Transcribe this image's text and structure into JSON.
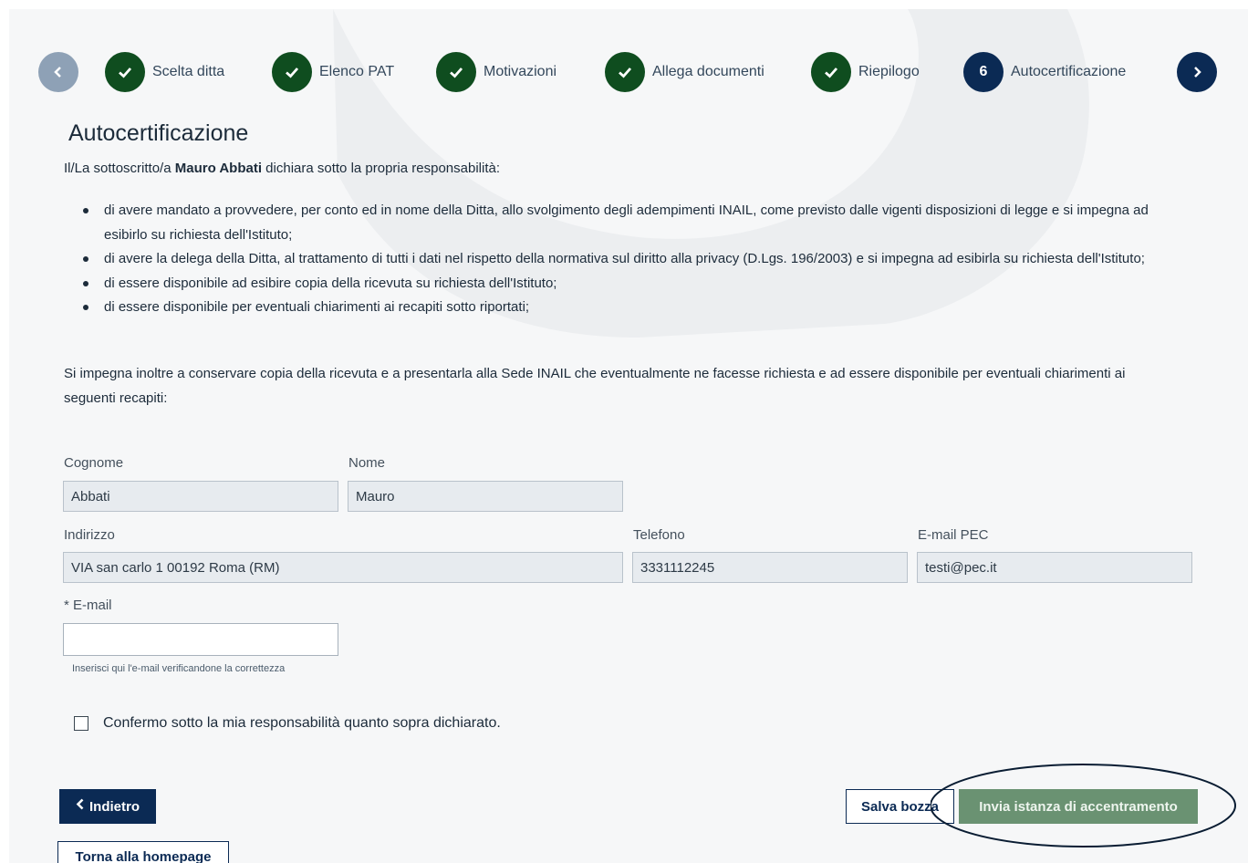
{
  "stepper": {
    "prev_icon": "chevron-left-icon",
    "next_icon": "chevron-right-icon",
    "steps": [
      {
        "label": "Scelta ditta",
        "status": "completed",
        "icon": "check-icon"
      },
      {
        "label": "Elenco PAT",
        "status": "completed",
        "icon": "check-icon"
      },
      {
        "label": "Motivazioni",
        "status": "completed",
        "icon": "check-icon"
      },
      {
        "label": "Allega documenti",
        "status": "completed",
        "icon": "check-icon"
      },
      {
        "label": "Riepilogo",
        "status": "completed",
        "icon": "check-icon"
      },
      {
        "label": "Autocertificazione",
        "status": "active",
        "number": "6"
      }
    ]
  },
  "page": {
    "title": "Autocertificazione",
    "intro_prefix": "Il/La sottoscritto/a ",
    "intro_name": "Mauro Abbati",
    "intro_suffix": " dichiara sotto la propria responsabilità:",
    "bullets": [
      "di avere mandato a provvedere, per conto ed in nome della Ditta, allo svolgimento degli adempimenti INAIL, come previsto dalle vigenti disposizioni di legge e si impegna ad esibirlo su richiesta dell'Istituto;",
      "di avere la delega della Ditta, al trattamento di tutti i dati nel rispetto della normativa sul diritto alla privacy (D.Lgs. 196/2003) e si impegna ad esibirla su richiesta dell'Istituto;",
      "di essere disponibile ad esibire copia della ricevuta su richiesta dell'Istituto;",
      "di essere disponibile per eventuali chiarimenti ai recapiti sotto riportati;"
    ],
    "commitment": "Si impegna inoltre a conservare copia della ricevuta e a presentarla alla Sede INAIL che eventualmente ne facesse richiesta e ad essere disponibile per eventuali chiarimenti ai seguenti recapiti:"
  },
  "form": {
    "cognome_label": "Cognome",
    "cognome_value": "Abbati",
    "nome_label": "Nome",
    "nome_value": "Mauro",
    "indirizzo_label": "Indirizzo",
    "indirizzo_value": "VIA san carlo 1 00192 Roma (RM)",
    "telefono_label": "Telefono",
    "telefono_value": "3331112245",
    "pec_label": "E-mail PEC",
    "pec_value": "testi@pec.it",
    "email_label": "* E-mail",
    "email_value": "",
    "email_hint": "Inserisci qui l'e-mail verificandone la correttezza",
    "confirm_label": "Confermo sotto la mia responsabilità quanto sopra dichiarato.",
    "confirm_checked": false
  },
  "actions": {
    "back_label": "Indietro",
    "back_icon": "chevron-left-icon",
    "draft_label": "Salva bozza",
    "submit_label": "Invia istanza di accentramento",
    "home_label": "Torna alla homepage"
  },
  "colors": {
    "primary": "#0b2a54",
    "completed_step": "#0f4d1f",
    "submit": "#6a9272",
    "readonly_field": "#e7ebef"
  }
}
